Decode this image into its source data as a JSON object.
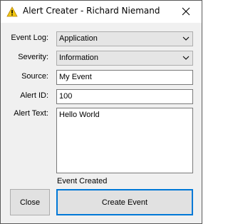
{
  "window": {
    "title": "Alert Creater - Richard Niemand",
    "title_icon": "warning-icon",
    "close_icon": "close-icon"
  },
  "form": {
    "event_log": {
      "label": "Event Log:",
      "value": "Application"
    },
    "severity": {
      "label": "Severity:",
      "value": "Information"
    },
    "source": {
      "label": "Source:",
      "value": "My Event"
    },
    "alert_id": {
      "label": "Alert ID:",
      "value": "100"
    },
    "alert_text": {
      "label": "Alert Text:",
      "value": "Hello World"
    }
  },
  "status": {
    "text": "Event Created"
  },
  "buttons": {
    "close_label": "Close",
    "create_label": "Create Event"
  },
  "colors": {
    "accent": "#0078d7",
    "warning": "#f2c811",
    "background": "#f0f0f0"
  }
}
